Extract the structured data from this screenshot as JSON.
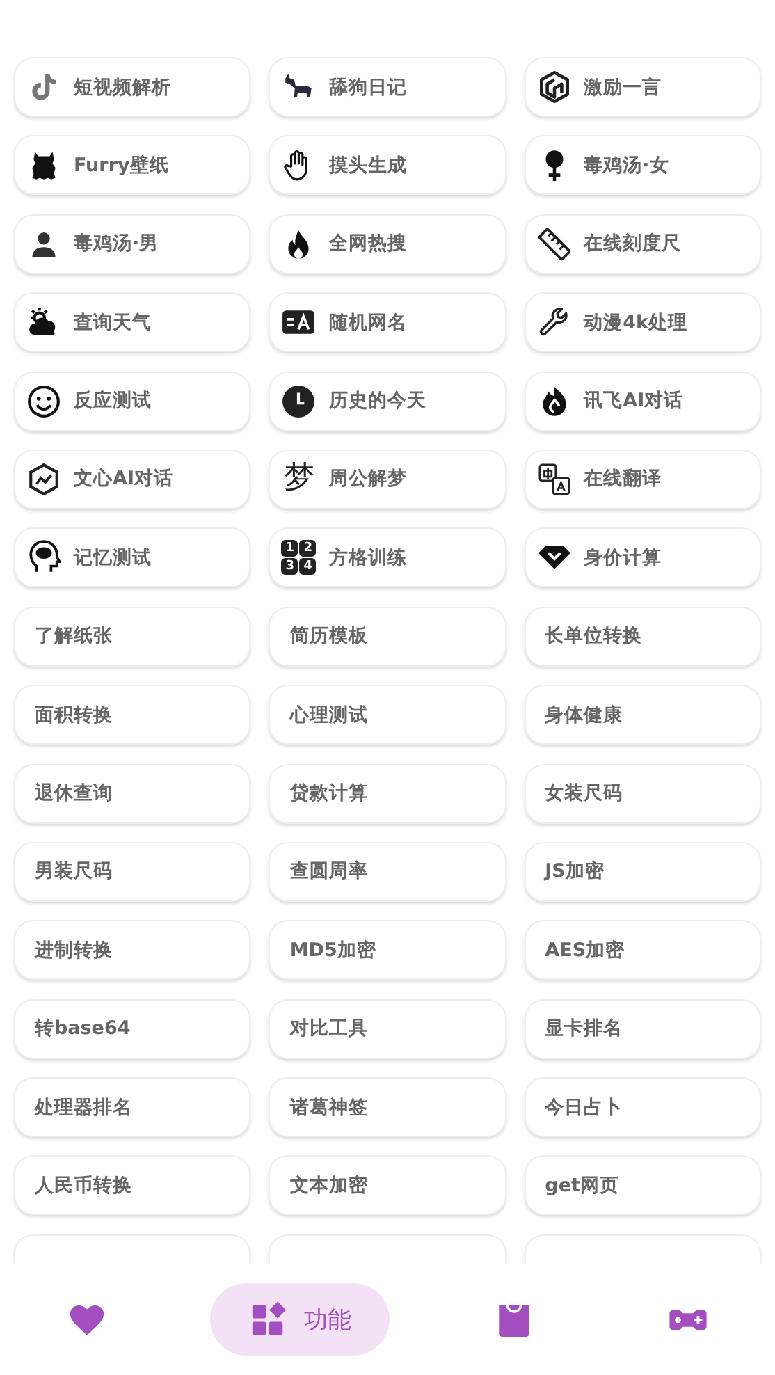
{
  "tools": [
    {
      "kind": "icon",
      "label": "短视频解析"
    },
    {
      "kind": "icon",
      "label": "舔狗日记"
    },
    {
      "kind": "icon",
      "label": "激励一言"
    },
    {
      "kind": "icon",
      "label": "Furry壁纸"
    },
    {
      "kind": "icon",
      "label": "摸头生成"
    },
    {
      "kind": "icon",
      "label": "毒鸡汤·女"
    },
    {
      "kind": "icon",
      "label": "毒鸡汤·男"
    },
    {
      "kind": "icon",
      "label": "全网热搜"
    },
    {
      "kind": "icon",
      "label": "在线刻度尺"
    },
    {
      "kind": "icon",
      "label": "查询天气"
    },
    {
      "kind": "icon",
      "label": "随机网名"
    },
    {
      "kind": "icon",
      "label": "动漫4k处理"
    },
    {
      "kind": "icon",
      "label": "反应测试"
    },
    {
      "kind": "icon",
      "label": "历史的今天"
    },
    {
      "kind": "icon",
      "label": "讯飞AI对话"
    },
    {
      "kind": "icon",
      "label": "文心AI对话"
    },
    {
      "kind": "glyph",
      "glyph": "梦",
      "label": "周公解梦"
    },
    {
      "kind": "icon",
      "label": "在线翻译"
    },
    {
      "kind": "icon",
      "label": "记忆测试"
    },
    {
      "kind": "numgrid",
      "glyphs": [
        "1",
        "2",
        "3",
        "4"
      ],
      "label": "方格训练"
    },
    {
      "kind": "icon",
      "label": "身价计算"
    },
    {
      "kind": "plain",
      "label": "了解纸张"
    },
    {
      "kind": "plain",
      "label": "简历模板"
    },
    {
      "kind": "plain",
      "label": "长单位转换"
    },
    {
      "kind": "plain",
      "label": "面积转换"
    },
    {
      "kind": "plain",
      "label": "心理测试"
    },
    {
      "kind": "plain",
      "label": "身体健康"
    },
    {
      "kind": "plain",
      "label": "退休查询"
    },
    {
      "kind": "plain",
      "label": "贷款计算"
    },
    {
      "kind": "plain",
      "label": "女装尺码"
    },
    {
      "kind": "plain",
      "label": "男装尺码"
    },
    {
      "kind": "plain",
      "label": "查圆周率"
    },
    {
      "kind": "plain",
      "label": "JS加密"
    },
    {
      "kind": "plain",
      "label": "进制转换"
    },
    {
      "kind": "plain",
      "label": "MD5加密"
    },
    {
      "kind": "plain",
      "label": "AES加密"
    },
    {
      "kind": "plain",
      "label": "转base64"
    },
    {
      "kind": "plain",
      "label": "对比工具"
    },
    {
      "kind": "plain",
      "label": "显卡排名"
    },
    {
      "kind": "plain",
      "label": "处理器排名"
    },
    {
      "kind": "plain",
      "label": "诸葛神签"
    },
    {
      "kind": "plain",
      "label": "今日占卜"
    },
    {
      "kind": "plain",
      "label": "人民币转换"
    },
    {
      "kind": "plain",
      "label": "文本加密"
    },
    {
      "kind": "plain",
      "label": "get网页"
    },
    {
      "kind": "blank"
    },
    {
      "kind": "blank"
    },
    {
      "kind": "blank"
    }
  ],
  "nav": [
    {
      "selected": false
    },
    {
      "selected": true,
      "label": "功能"
    },
    {
      "selected": false
    },
    {
      "selected": false
    }
  ]
}
